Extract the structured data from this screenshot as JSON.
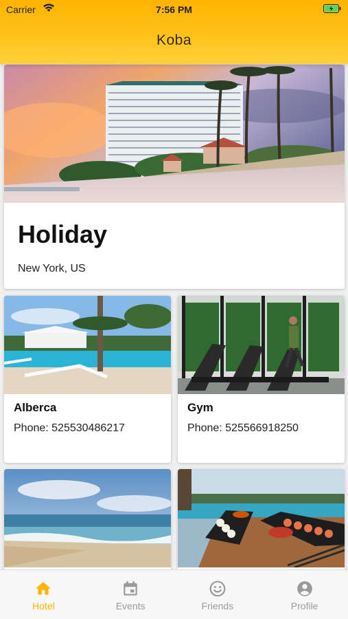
{
  "status_bar": {
    "carrier": "Carrier",
    "time": "7:56 PM",
    "icons": [
      "wifi-icon",
      "battery-charging-icon"
    ]
  },
  "header": {
    "title": "Koba",
    "gradient": [
      "#ffb300",
      "#ffd03a"
    ]
  },
  "hero": {
    "name": "Holiday",
    "location": "New York, US",
    "image": "hotel-beach-photo"
  },
  "amenities": [
    {
      "name": "Alberca",
      "phone": "Phone: 525530486217",
      "image": "pool-photo"
    },
    {
      "name": "Gym",
      "phone": "Phone: 525566918250",
      "image": "gym-photo"
    },
    {
      "name": "",
      "phone": "",
      "image": "beach-photo"
    },
    {
      "name": "",
      "phone": "",
      "image": "sushi-restaurant-photo"
    }
  ],
  "tabs": [
    {
      "label": "Hotel",
      "icon": "home-icon",
      "active": true
    },
    {
      "label": "Events",
      "icon": "calendar-icon",
      "active": false
    },
    {
      "label": "Friends",
      "icon": "smiley-icon",
      "active": false
    },
    {
      "label": "Profile",
      "icon": "profile-icon",
      "active": false
    }
  ],
  "colors": {
    "accent": "#ffb400",
    "inactive": "#9a9a9a"
  }
}
